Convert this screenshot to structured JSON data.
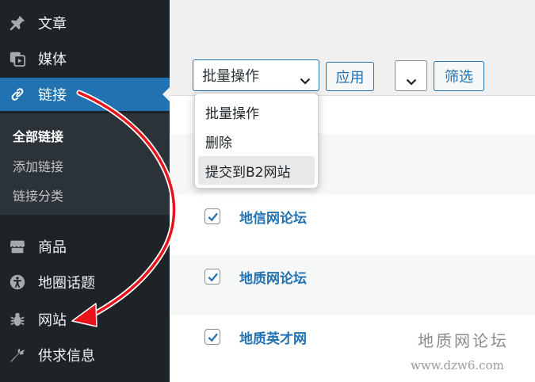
{
  "sidebar": {
    "items": [
      {
        "label": "文章",
        "icon": "pin-icon"
      },
      {
        "label": "媒体",
        "icon": "media-icon"
      },
      {
        "label": "链接",
        "icon": "link-icon"
      },
      {
        "label": "商品",
        "icon": "store-icon"
      },
      {
        "label": "地圈话题",
        "icon": "topic-icon"
      },
      {
        "label": "网站",
        "icon": "bug-icon"
      },
      {
        "label": "供求信息",
        "icon": "carrot-icon"
      }
    ],
    "submenu": [
      "全部链接",
      "添加链接",
      "链接分类"
    ]
  },
  "toolbar": {
    "bulk_select": "批量操作",
    "apply_label": "应用",
    "filter_label": "筛选"
  },
  "dropdown": {
    "options": [
      "批量操作",
      "删除",
      "提交到B2网站"
    ]
  },
  "rows": [
    {
      "title": "地信网论坛",
      "checked": true
    },
    {
      "title": "地质网论坛",
      "checked": true
    },
    {
      "title": "地质英才网",
      "checked": true
    }
  ],
  "watermark": {
    "title": "地质网论坛",
    "url": "www.dzw6.com"
  },
  "colors": {
    "sidebar_bg": "#1d2327",
    "accent": "#2271b1",
    "arrow": "#e8141b"
  }
}
